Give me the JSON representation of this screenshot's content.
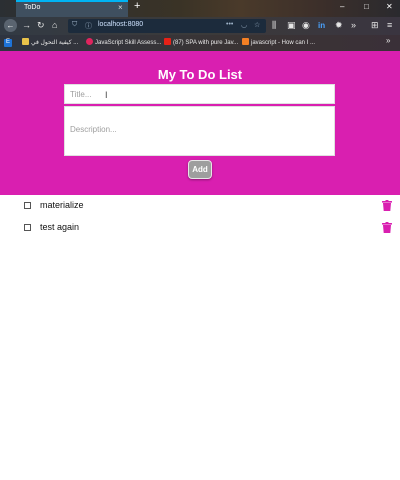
{
  "browser": {
    "tab_title": "ToDo",
    "tab_close": "×",
    "new_tab": "+",
    "window_buttons": {
      "minimize": "–",
      "maximize": "□",
      "close": "✕"
    },
    "url": "localhost:8080",
    "bookmarks": [
      {
        "label": "E",
        "color": "#1e73d8"
      },
      {
        "label": "كيفية التحول في ...",
        "color": "#e8c24a"
      },
      {
        "label": "JavaScript Skill Assess...",
        "color": "#e0245e"
      },
      {
        "label": "(87) SPA with pure Jav...",
        "color": "#e62117"
      },
      {
        "label": "javascript - How can I ...",
        "color": "#f48024"
      }
    ]
  },
  "app": {
    "title": "My To Do List",
    "title_placeholder": "Title...",
    "description_placeholder": "Description...",
    "add_label": "Add",
    "accent_color": "#d91fb0"
  },
  "todos": [
    {
      "text": "materialize",
      "checked": false
    },
    {
      "text": "test again",
      "checked": false
    }
  ]
}
